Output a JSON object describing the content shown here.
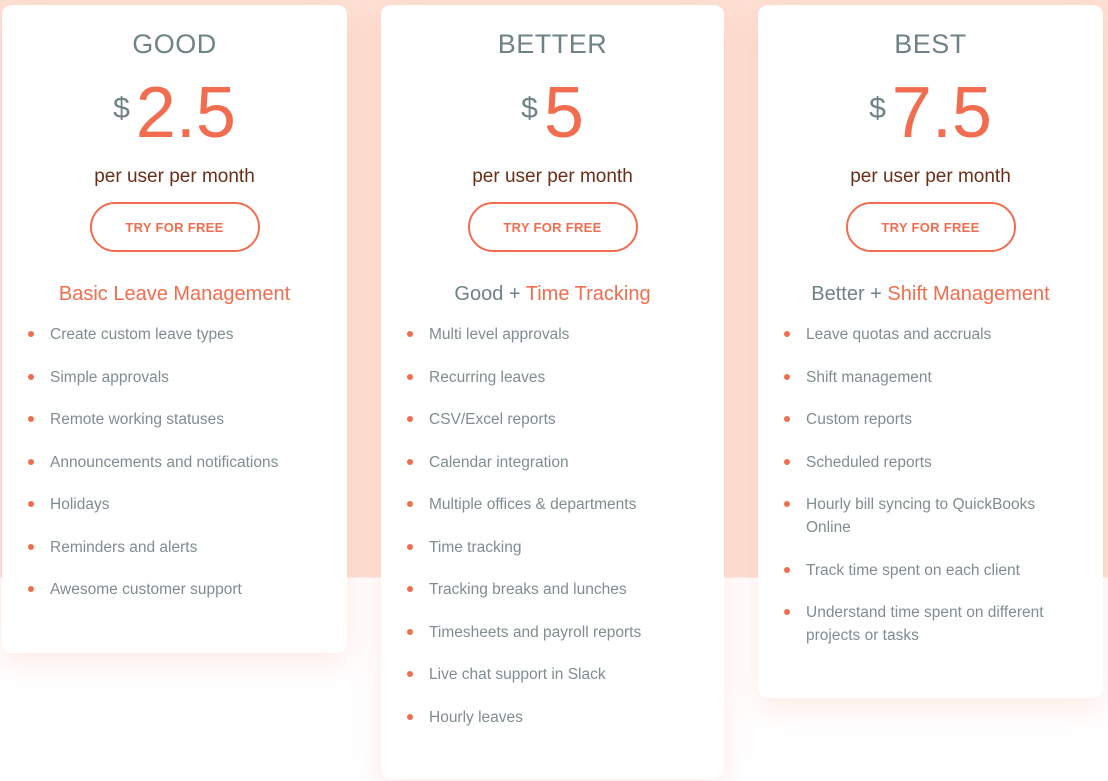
{
  "colors": {
    "accent": "#f26d4f",
    "muted_text": "#6f8285",
    "period_text": "#6b2e17",
    "background_band": "#fde0d4"
  },
  "plans": [
    {
      "tier": "GOOD",
      "currency": "$",
      "amount": "2.5",
      "period": "per user per month",
      "cta": "TRY FOR FREE",
      "subtitle_base": "",
      "subtitle_accent": "Basic Leave Management",
      "features": [
        "Create custom leave types",
        "Simple approvals",
        "Remote working statuses",
        "Announcements and notifications",
        "Holidays",
        "Reminders and alerts",
        "Awesome customer support"
      ]
    },
    {
      "tier": "BETTER",
      "currency": "$",
      "amount": "5",
      "period": "per user per month",
      "cta": "TRY FOR FREE",
      "subtitle_base": "Good + ",
      "subtitle_accent": "Time Tracking",
      "features": [
        "Multi level approvals",
        "Recurring leaves",
        "CSV/Excel reports",
        "Calendar integration",
        "Multiple offices & departments",
        "Time tracking",
        "Tracking breaks and lunches",
        "Timesheets and payroll reports",
        "Live chat support in Slack",
        "Hourly leaves"
      ]
    },
    {
      "tier": "BEST",
      "currency": "$",
      "amount": "7.5",
      "period": "per user per month",
      "cta": "TRY FOR FREE",
      "subtitle_base": "Better + ",
      "subtitle_accent": "Shift Management",
      "features": [
        "Leave quotas and accruals",
        "Shift management",
        "Custom reports",
        "Scheduled reports",
        "Hourly bill syncing to QuickBooks Online",
        "Track time spent on each client",
        "Understand time spent on different projects or tasks"
      ]
    }
  ]
}
